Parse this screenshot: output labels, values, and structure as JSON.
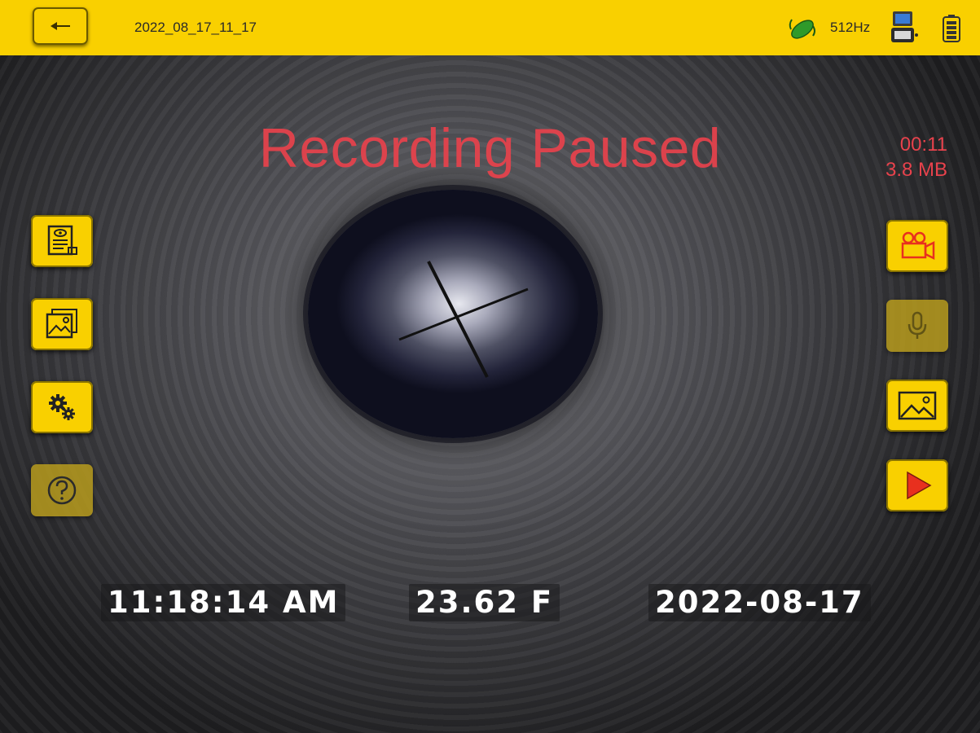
{
  "header": {
    "file_name": "2022_08_17_11_17",
    "frequency": "512Hz",
    "icons": [
      "back-arrow-icon",
      "sonde-icon",
      "device-icon",
      "battery-icon"
    ]
  },
  "recording": {
    "status": "Recording Paused",
    "elapsed": "00:11",
    "size": "3.8 MB"
  },
  "left_toolbar": [
    "report-icon",
    "gallery-icon",
    "settings-icon",
    "help-icon"
  ],
  "right_toolbar": [
    "video-camera-icon",
    "microphone-icon",
    "photo-icon",
    "play-icon"
  ],
  "overlay": {
    "time": "11:18:14 AM",
    "distance": "23.62 F",
    "date": "2022-08-17"
  },
  "colors": {
    "accent": "#f9d000",
    "record_red": "#e8424c",
    "play_red": "#e8301e"
  }
}
